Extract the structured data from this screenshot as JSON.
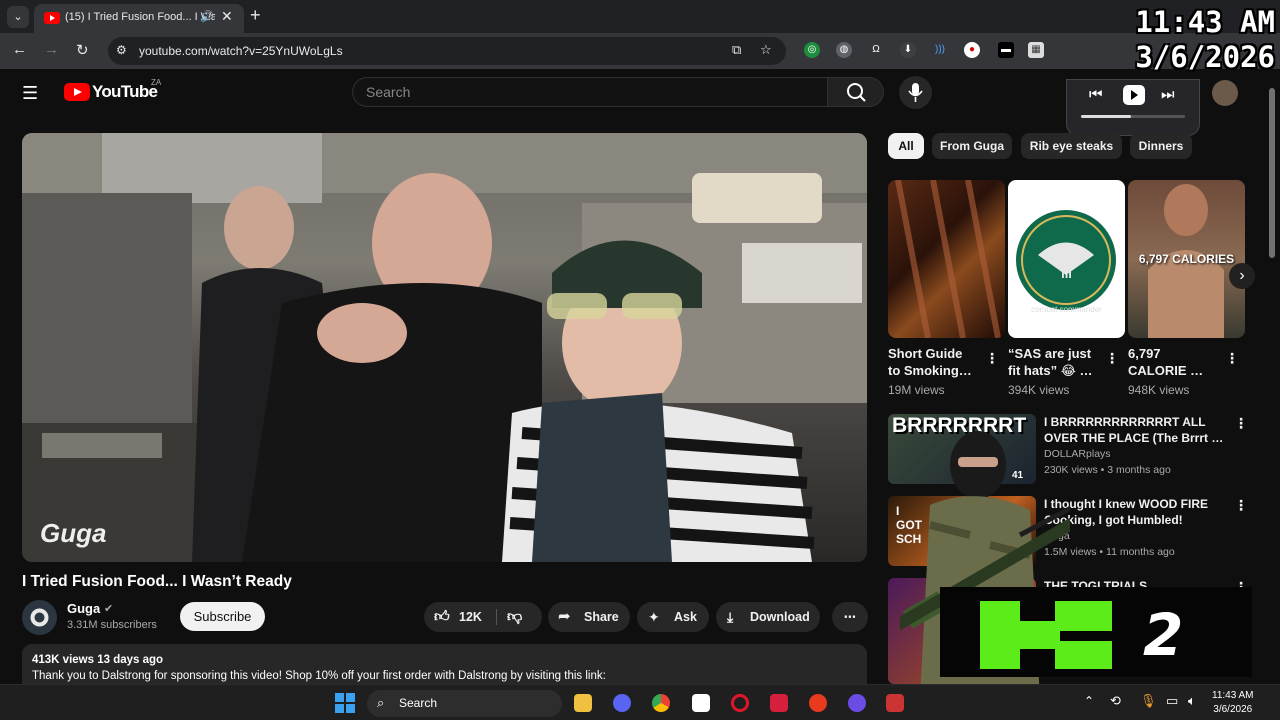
{
  "browser": {
    "tab_title": "(15) I Tried Fusion Food... I Wasn't Ready - YouTube",
    "new_tab": "+",
    "url": "youtube.com/watch?v=25YnUWoLgLs"
  },
  "youtube": {
    "logo_text": "YouTube",
    "country_code": "ZA",
    "search_placeholder": "Search"
  },
  "clock_overlay": {
    "time": "11:43 AM",
    "date": "3/6/2026"
  },
  "video": {
    "watermark": "Guga",
    "title": "I Tried Fusion Food... I Wasn’t Ready",
    "channel": "Guga",
    "subscribers": "3.31M subscribers",
    "subscribe_label": "Subscribe",
    "likes": "12K",
    "share_label": "Share",
    "ask_label": "Ask",
    "download_label": "Download",
    "views_date": "413K views  13 days ago",
    "description": "Thank you to Dalstrong for sponsoring this video! Shop 10% off your first order with Dalstrong by visiting this link:"
  },
  "chips": [
    "All",
    "From Guga",
    "Rib eye steaks",
    "Dinners"
  ],
  "shorts": [
    {
      "title": "Short Guide to Smoking…",
      "views": "19M views"
    },
    {
      "title": "“SAS are just fit hats” 😂 …",
      "views": "394K views",
      "thumb_caption": "combat commander",
      "thumb_numeral": "III"
    },
    {
      "title": "6,797 CALORIE …",
      "views": "948K views",
      "thumb_text": "6,797 CALORIES"
    }
  ],
  "recommendations": [
    {
      "title": "I BRRRRRRRRRRRRRT ALL OVER THE PLACE (The Brrrt …",
      "channel": "DOLLARplays",
      "meta": "230K views • 3 months ago",
      "thumb_text": "BRRRRRRRT",
      "badge": "41"
    },
    {
      "title": "I thought I knew WOOD FIRE Cooking, I got Humbled!",
      "channel": "Guga",
      "meta": "1.5M views • 11 months ago",
      "thumb_text": "I GOT SCH"
    },
    {
      "title": "THE TOGI TRIALS",
      "channel": "",
      "meta": ""
    }
  ],
  "overlay_logo": {
    "letters": "K",
    "number": "2"
  },
  "taskbar": {
    "search_label": "Search",
    "time": "11:43 AM",
    "date": "3/6/2026"
  },
  "colors": {
    "yt_red": "#ff0000",
    "k2_green": "#5bec1a",
    "bg": "#0f0f0f"
  }
}
